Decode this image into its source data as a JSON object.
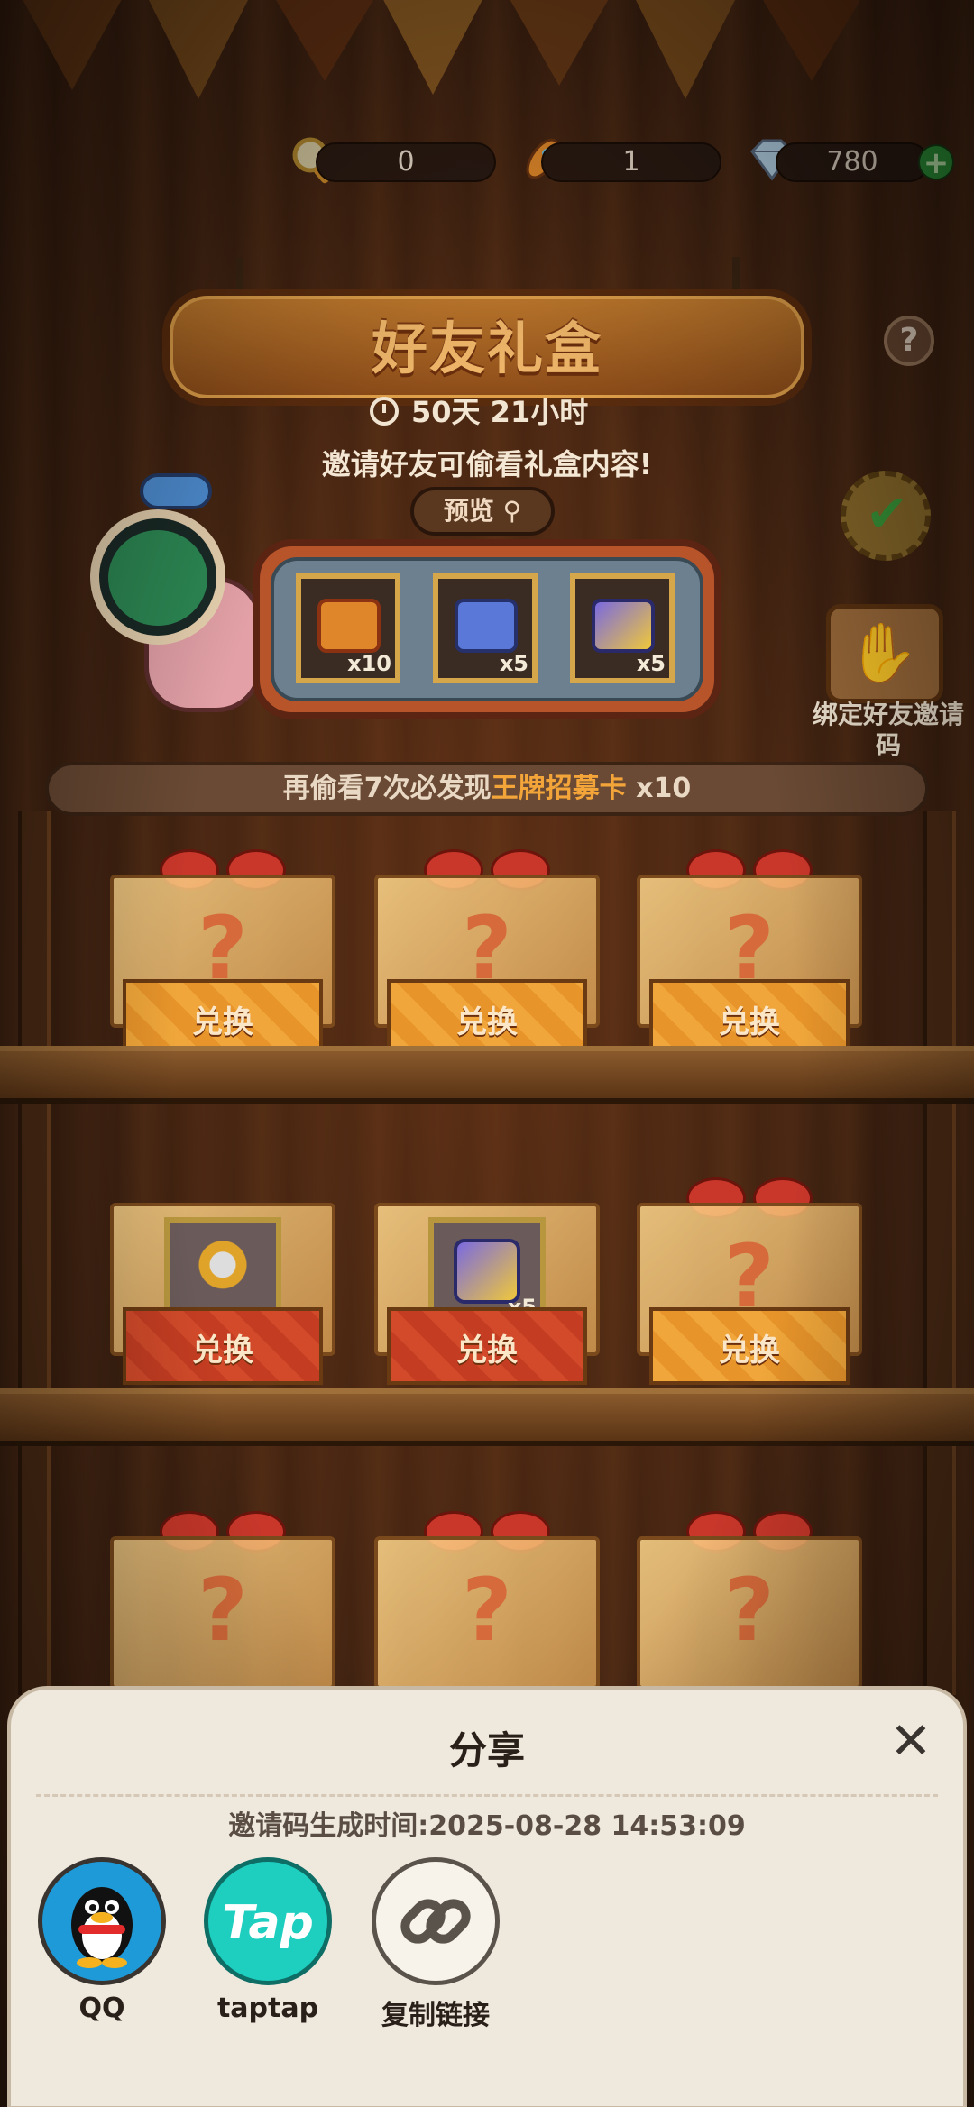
{
  "currency": {
    "magnifier": "0",
    "rocket": "1",
    "diamond": "780",
    "add": "+"
  },
  "header": {
    "title": "好友礼盒",
    "help": "?",
    "countdown": "50天  21小时",
    "subtitle": "邀请好友可偷看礼盒内容!"
  },
  "preview": {
    "label": "预览",
    "slots": [
      {
        "icon": "ticket-icon",
        "count": "x10"
      },
      {
        "icon": "blue-ticket-icon",
        "count": "x5"
      },
      {
        "icon": "cube-icon",
        "count": "x5"
      }
    ]
  },
  "bind": {
    "label": "绑定好友邀请码"
  },
  "hint": {
    "prefix": "再偷看7次必发现",
    "highlight": "王牌招募卡",
    "suffix": " x10"
  },
  "boxes": {
    "redeem_label": "兑换",
    "unknown_mark": "?",
    "revealed_ring_icon": "ring-icon",
    "revealed_cube_count": "x5"
  },
  "share": {
    "title": "分享",
    "close": "✕",
    "generated_time": "邀请码生成时间:2025-08-28  14:53:09",
    "targets": [
      {
        "label": "QQ",
        "icon": "qq-penguin-icon"
      },
      {
        "label": "taptap",
        "icon": "taptap-icon",
        "logo_text": "Tap"
      },
      {
        "label": "复制链接",
        "icon": "link-icon"
      }
    ]
  },
  "colors": {
    "accent_orange": "#f3a53a",
    "wood": "#4a2914",
    "sheet_bg": "#efe8dd",
    "taptap": "#1ecfc0",
    "qq_blue": "#1f9ad8"
  }
}
